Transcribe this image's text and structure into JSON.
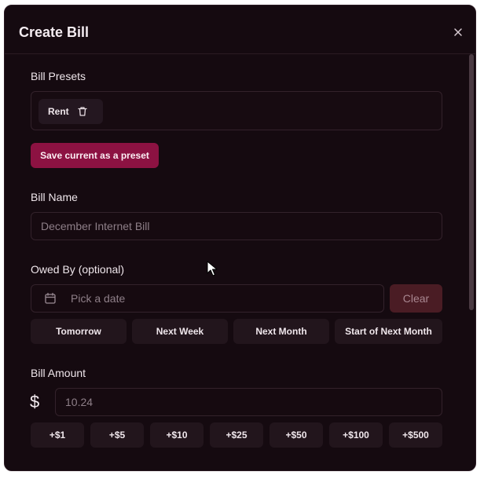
{
  "dialog": {
    "title": "Create Bill",
    "close_icon": "close-icon"
  },
  "presets": {
    "label": "Bill Presets",
    "items": [
      {
        "name": "Rent",
        "icon": "trash-icon"
      }
    ],
    "save_label": "Save current as a preset"
  },
  "bill_name": {
    "label": "Bill Name",
    "placeholder": "December Internet Bill",
    "value": ""
  },
  "owed_by": {
    "label": "Owed By (optional)",
    "placeholder": "Pick a date",
    "icon": "calendar-icon",
    "clear_label": "Clear",
    "quick_options": [
      "Tomorrow",
      "Next Week",
      "Next Month",
      "Start of Next Month"
    ]
  },
  "amount": {
    "label": "Bill Amount",
    "currency_symbol": "$",
    "placeholder": "10.24",
    "increments": [
      "+$1",
      "+$5",
      "+$10",
      "+$25",
      "+$50",
      "+$100",
      "+$500"
    ]
  },
  "colors": {
    "background": "#150a10",
    "accent": "#8c1242",
    "clear_button": "#4a1c24"
  }
}
